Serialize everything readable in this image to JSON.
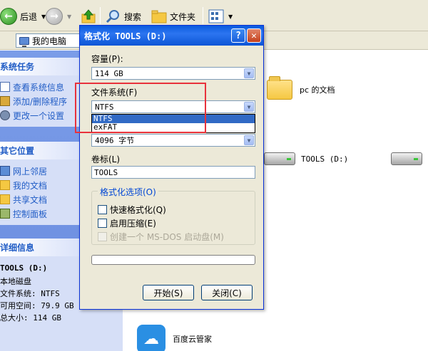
{
  "toolbar": {
    "back_label": "后退",
    "search_label": "搜索",
    "folders_label": "文件夹"
  },
  "address": {
    "value": "我的电脑"
  },
  "tasks": {
    "system_title": "系统任务",
    "system_items": [
      "查看系统信息",
      "添加/删除程序",
      "更改一个设置"
    ],
    "places_title": "其它位置",
    "places_items": [
      "网上邻居",
      "我的文档",
      "共享文档",
      "控制面板"
    ],
    "details_title": "详细信息",
    "details_lines": [
      "TOOLS (D:)",
      "本地磁盘",
      "文件系统: NTFS",
      "可用空间: 79.9 GB",
      "总大小: 114 GB"
    ]
  },
  "content": {
    "docs_label": "pc 的文档",
    "drive_label": "TOOLS (D:)",
    "cloud_label": "百度云管家"
  },
  "dialog": {
    "title": "格式化 TOOLS (D:)",
    "capacity_label": "容量(P):",
    "capacity_value": "114 GB",
    "fs_label": "文件系统(F)",
    "fs_value": "NTFS",
    "fs_options": [
      "NTFS",
      "exFAT"
    ],
    "cluster_value": "4096 字节",
    "volume_label": "卷标(L)",
    "volume_value": "TOOLS",
    "options_title": "格式化选项(O)",
    "quick_format": "快速格式化(Q)",
    "compression": "启用压缩(E)",
    "msdos": "创建一个 MS-DOS 启动盘(M)",
    "start_button": "开始(S)",
    "close_button": "关闭(C)"
  }
}
